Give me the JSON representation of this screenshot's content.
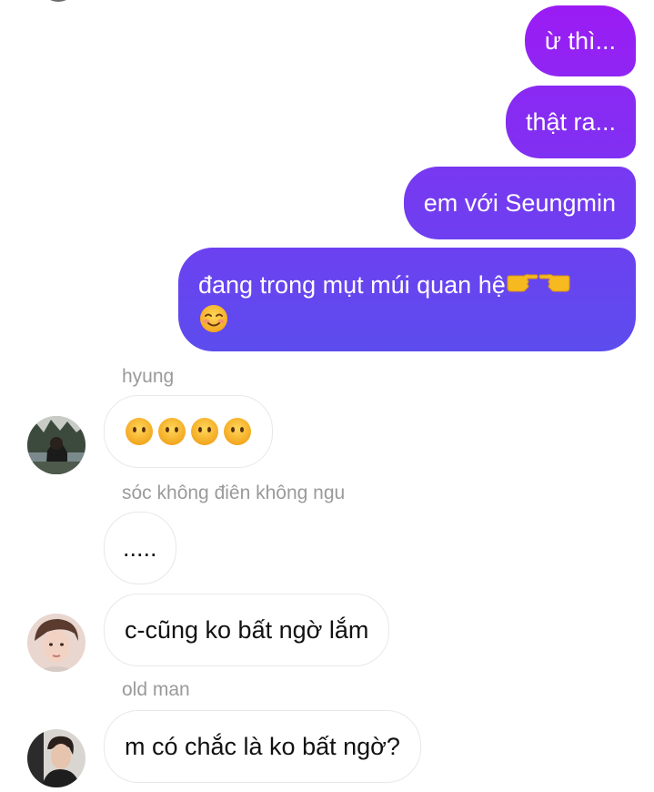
{
  "outgoing": [
    {
      "text": "ừ thì..."
    },
    {
      "text": "thật ra..."
    },
    {
      "text": "em với Seungmin"
    },
    {
      "text": "đang trong mụt múi quan hệ",
      "emoji": [
        "backhand-index-pointing-right",
        "backhand-index-pointing-left",
        "smiling-face-with-smiling-eyes"
      ]
    }
  ],
  "incoming": [
    {
      "sender": "hyung",
      "emoji": [
        "neutral-face-no-mouth",
        "neutral-face-no-mouth",
        "neutral-face-no-mouth",
        "neutral-face-no-mouth"
      ]
    },
    {
      "sender": "sóc không điên không ngu",
      "text": "....."
    },
    {
      "text": "c-cũng ko bất ngờ lắm"
    },
    {
      "sender": "old man",
      "text": "m có chắc là ko bất ngờ?"
    }
  ],
  "colors": {
    "outgoing_gradient_top": "#9b1ff3",
    "outgoing_gradient_bottom": "#5a48ee",
    "incoming_bg": "#ffffff",
    "sender_label": "#9a9a9a"
  }
}
